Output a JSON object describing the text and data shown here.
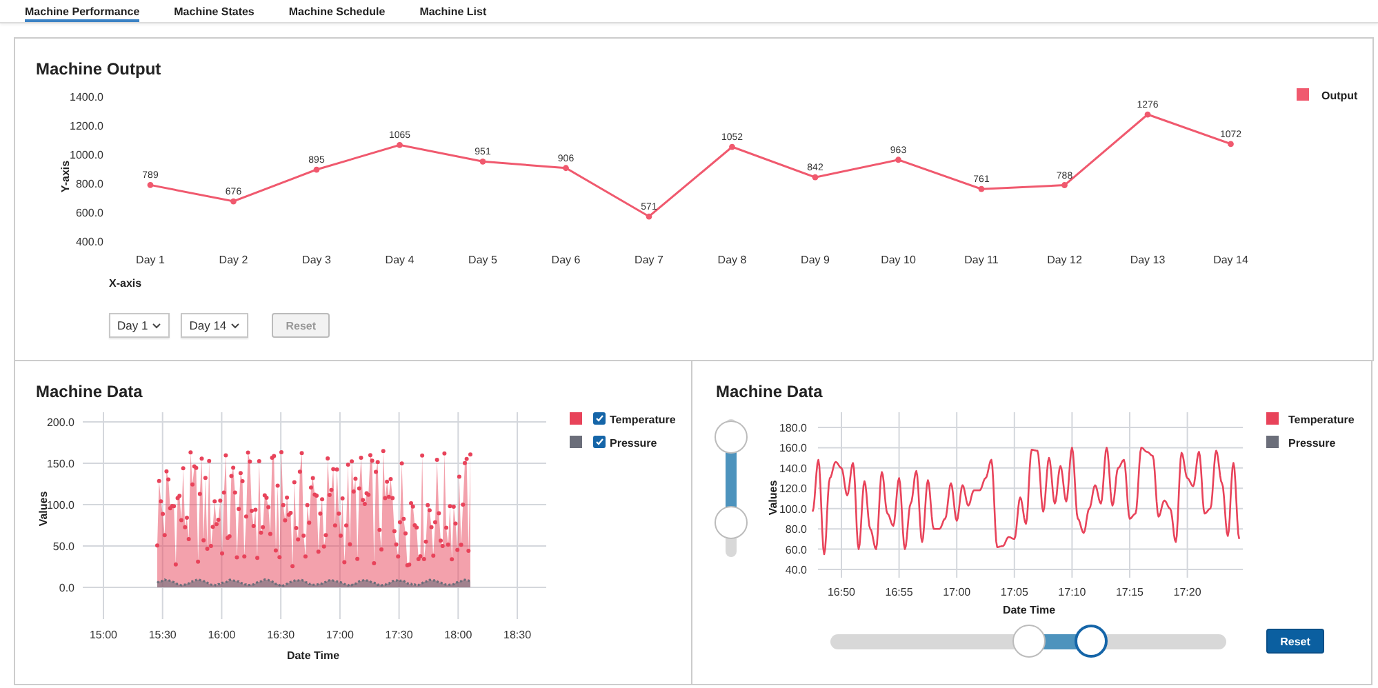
{
  "tabs": [
    {
      "label": "Machine Performance",
      "selected": true
    },
    {
      "label": "Machine States",
      "selected": false
    },
    {
      "label": "Machine Schedule",
      "selected": false
    },
    {
      "label": "Machine List",
      "selected": false
    }
  ],
  "output_panel": {
    "title": "Machine Output",
    "chart_data": {
      "type": "line",
      "xlabel": "X-axis",
      "ylabel": "Y-axis",
      "categories": [
        "Day 1",
        "Day 2",
        "Day 3",
        "Day 4",
        "Day 5",
        "Day 6",
        "Day 7",
        "Day 8",
        "Day 9",
        "Day 10",
        "Day 11",
        "Day 12",
        "Day 13",
        "Day 14"
      ],
      "series": [
        {
          "name": "Output",
          "color": "#f0596e",
          "marker": true,
          "values": [
            789,
            676,
            895,
            1065,
            951,
            906,
            571,
            1052,
            842,
            963,
            761,
            788,
            1276,
            1072
          ]
        }
      ],
      "ylim": [
        400,
        1400
      ],
      "yticks": [
        {
          "value": 1400,
          "label": "1400.0"
        },
        {
          "value": 1200,
          "label": "1200.0"
        },
        {
          "value": 1000,
          "label": "1000.0"
        },
        {
          "value": 800,
          "label": "800.0"
        },
        {
          "value": 600,
          "label": "600.0"
        },
        {
          "value": 400,
          "label": "400.0"
        }
      ],
      "data_labels": true
    },
    "range_start": "Day 1",
    "range_end": "Day 14",
    "reset": {
      "label": "Reset",
      "disabled": true
    }
  },
  "data_panel": {
    "title": "Machine Data",
    "ylabel": "Values",
    "xlabel": "Date Time",
    "yticks": [
      "200.0",
      "150.0",
      "100.0",
      "50.0",
      "0.0"
    ],
    "xticks": [
      "15:00",
      "15:30",
      "16:00",
      "16:30",
      "17:00",
      "17:30",
      "18:00",
      "18:30"
    ],
    "legend": [
      {
        "name": "Temperature",
        "color": "#e8435a",
        "checked": true
      },
      {
        "name": "Pressure",
        "color": "#6b6e7a",
        "checked": true
      }
    ]
  },
  "zoom_panel": {
    "title": "Machine Data",
    "chart_data": {
      "type": "line",
      "xlabel": "Date Time",
      "ylabel": "Values",
      "ylim": [
        40,
        180
      ],
      "grid": true,
      "categories": [
        null,
        null,
        null,
        null,
        null,
        "16:50",
        null,
        null,
        null,
        null,
        null,
        null,
        null,
        null,
        null,
        "16:55",
        null,
        null,
        null,
        null,
        null,
        null,
        null,
        null,
        null,
        "17:00",
        null,
        null,
        null,
        null,
        null,
        null,
        null,
        null,
        null,
        "17:05",
        null,
        null,
        null,
        null,
        null,
        null,
        null,
        null,
        null,
        "17:10",
        null,
        null,
        null,
        null,
        null,
        null,
        null,
        null,
        null,
        "17:15",
        null,
        null,
        null,
        null,
        null,
        null,
        null,
        null,
        null,
        "17:20",
        null,
        null,
        null,
        null,
        null,
        null,
        null,
        null,
        null
      ],
      "yticks": [
        {
          "value": 180,
          "label": "180.0"
        },
        {
          "value": 160,
          "label": "160.0"
        },
        {
          "value": 140,
          "label": "140.0"
        },
        {
          "value": 120,
          "label": "120.0"
        },
        {
          "value": 100,
          "label": "100.0"
        },
        {
          "value": 80,
          "label": "80.0"
        },
        {
          "value": 60,
          "label": "60.0"
        },
        {
          "value": 40,
          "label": "40.0"
        }
      ],
      "series": [
        {
          "name": "Temperature",
          "color": "#e8435a",
          "values": [
            97,
            148,
            55,
            130,
            146,
            140,
            113,
            145,
            60,
            127,
            80,
            60,
            136,
            95,
            83,
            130,
            60,
            105,
            137,
            67,
            128,
            80,
            80,
            90,
            125,
            88,
            123,
            103,
            118,
            118,
            130,
            148,
            62,
            63,
            72,
            70,
            111,
            85,
            158,
            157,
            97,
            150,
            105,
            142,
            107,
            160,
            90,
            76,
            100,
            123,
            105,
            160,
            103,
            140,
            148,
            90,
            95,
            160,
            156,
            152,
            92,
            108,
            100,
            67,
            155,
            130,
            122,
            156,
            95,
            100,
            157,
            125,
            73,
            145,
            70
          ]
        }
      ]
    },
    "legend": [
      {
        "name": "Pressure",
        "color": "#6b6e7a"
      }
    ],
    "vertical_slider": {
      "thumbs": [
        {
          "level": 0.87
        },
        {
          "level": 0.25
        }
      ]
    },
    "horizontal_slider": {
      "thumbs": [
        {
          "level": 0.5,
          "focused": false
        },
        {
          "level": 0.66,
          "focused": true
        }
      ]
    },
    "reset": {
      "label": "Reset",
      "disabled": false
    }
  }
}
